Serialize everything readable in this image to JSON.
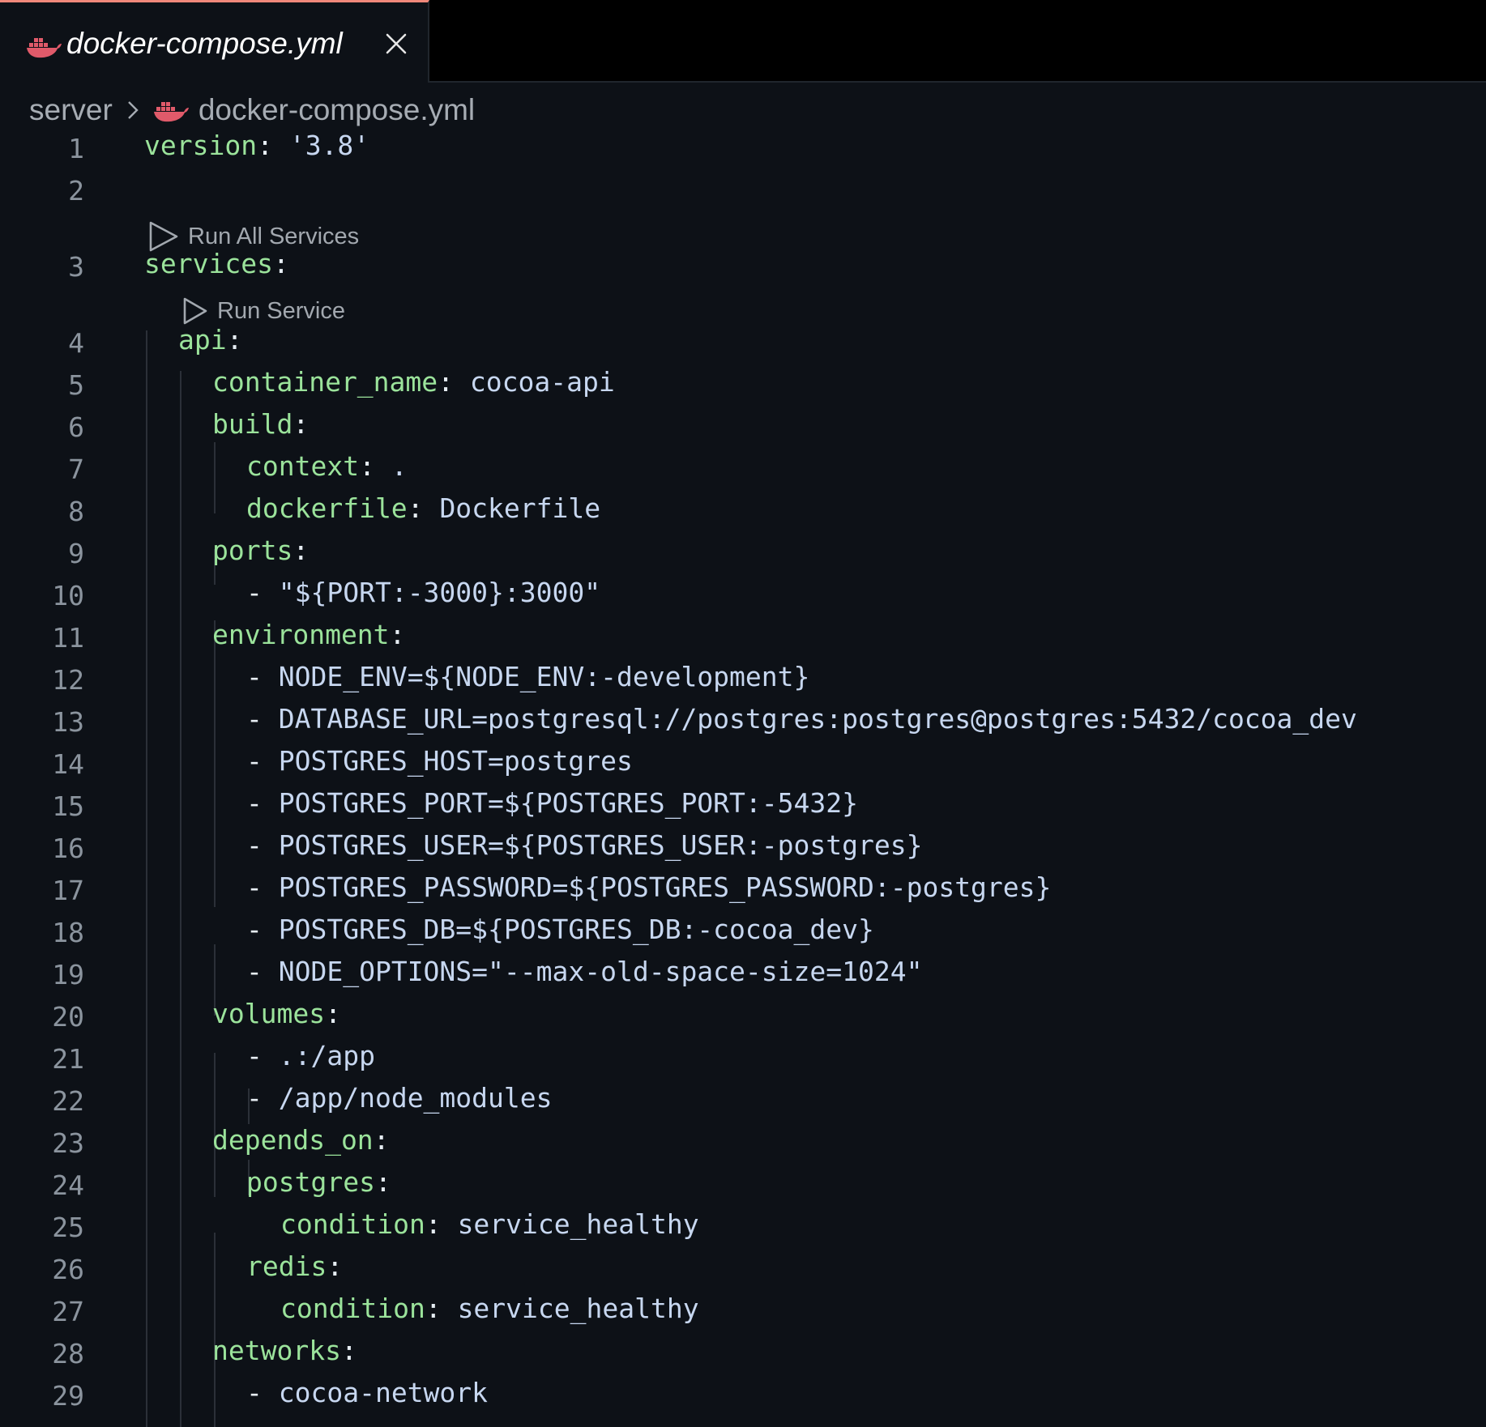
{
  "tab": {
    "label": "docker-compose.yml",
    "icon": "docker-whale-icon",
    "accent": "#f0887a"
  },
  "breadcrumb": {
    "folder": "server",
    "file": "docker-compose.yml"
  },
  "codelens": {
    "run_all": "Run All Services",
    "run_service": "Run Service"
  },
  "colors": {
    "background": "#0d1117",
    "key": "#9be39b",
    "value": "#c7d7f0",
    "line_number": "#8b949e",
    "docker_icon": "#e05a6a"
  },
  "lines": [
    {
      "n": "1",
      "indent": 0,
      "key": "version",
      "sep": ": ",
      "val": "'3.8'"
    },
    {
      "n": "2",
      "indent": 0,
      "key": "",
      "sep": "",
      "val": ""
    },
    {
      "n": "3",
      "indent": 0,
      "key": "services",
      "sep": ":",
      "val": ""
    },
    {
      "n": "4",
      "indent": 1,
      "key": "api",
      "sep": ":",
      "val": ""
    },
    {
      "n": "5",
      "indent": 2,
      "key": "container_name",
      "sep": ": ",
      "val": "cocoa-api"
    },
    {
      "n": "6",
      "indent": 2,
      "key": "build",
      "sep": ":",
      "val": ""
    },
    {
      "n": "7",
      "indent": 3,
      "key": "context",
      "sep": ": ",
      "val": "."
    },
    {
      "n": "8",
      "indent": 3,
      "key": "dockerfile",
      "sep": ": ",
      "val": "Dockerfile"
    },
    {
      "n": "9",
      "indent": 2,
      "key": "ports",
      "sep": ":",
      "val": ""
    },
    {
      "n": "10",
      "indent": 3,
      "key": "",
      "sep": "- ",
      "val": "\"${PORT:-3000}:3000\""
    },
    {
      "n": "11",
      "indent": 2,
      "key": "environment",
      "sep": ":",
      "val": ""
    },
    {
      "n": "12",
      "indent": 3,
      "key": "",
      "sep": "- ",
      "val": "NODE_ENV=${NODE_ENV:-development}"
    },
    {
      "n": "13",
      "indent": 3,
      "key": "",
      "sep": "- ",
      "val": "DATABASE_URL=postgresql://postgres:postgres@postgres:5432/cocoa_dev"
    },
    {
      "n": "14",
      "indent": 3,
      "key": "",
      "sep": "- ",
      "val": "POSTGRES_HOST=postgres"
    },
    {
      "n": "15",
      "indent": 3,
      "key": "",
      "sep": "- ",
      "val": "POSTGRES_PORT=${POSTGRES_PORT:-5432}"
    },
    {
      "n": "16",
      "indent": 3,
      "key": "",
      "sep": "- ",
      "val": "POSTGRES_USER=${POSTGRES_USER:-postgres}"
    },
    {
      "n": "17",
      "indent": 3,
      "key": "",
      "sep": "- ",
      "val": "POSTGRES_PASSWORD=${POSTGRES_PASSWORD:-postgres}"
    },
    {
      "n": "18",
      "indent": 3,
      "key": "",
      "sep": "- ",
      "val": "POSTGRES_DB=${POSTGRES_DB:-cocoa_dev}"
    },
    {
      "n": "19",
      "indent": 3,
      "key": "",
      "sep": "- ",
      "val": "NODE_OPTIONS=\"--max-old-space-size=1024\""
    },
    {
      "n": "20",
      "indent": 2,
      "key": "volumes",
      "sep": ":",
      "val": ""
    },
    {
      "n": "21",
      "indent": 3,
      "key": "",
      "sep": "- ",
      "val": ".:/app"
    },
    {
      "n": "22",
      "indent": 3,
      "key": "",
      "sep": "- ",
      "val": "/app/node_modules"
    },
    {
      "n": "23",
      "indent": 2,
      "key": "depends_on",
      "sep": ":",
      "val": ""
    },
    {
      "n": "24",
      "indent": 3,
      "key": "postgres",
      "sep": ":",
      "val": ""
    },
    {
      "n": "25",
      "indent": 4,
      "key": "condition",
      "sep": ": ",
      "val": "service_healthy"
    },
    {
      "n": "26",
      "indent": 3,
      "key": "redis",
      "sep": ":",
      "val": ""
    },
    {
      "n": "27",
      "indent": 4,
      "key": "condition",
      "sep": ": ",
      "val": "service_healthy"
    },
    {
      "n": "28",
      "indent": 2,
      "key": "networks",
      "sep": ":",
      "val": ""
    },
    {
      "n": "29",
      "indent": 3,
      "key": "",
      "sep": "- ",
      "val": "cocoa-network"
    }
  ]
}
